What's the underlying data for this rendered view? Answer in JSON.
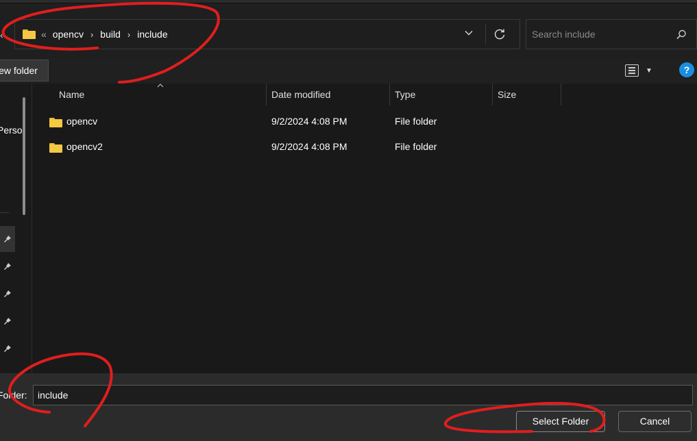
{
  "address_bar": {
    "overflow_glyph": "«",
    "breadcrumbs": [
      "opencv",
      "build",
      "include"
    ],
    "separator": "›",
    "dropdown_glyph": "⌄"
  },
  "search": {
    "placeholder": "Search include"
  },
  "command_bar": {
    "new_folder_label": "New folder",
    "help_label": "?"
  },
  "nav_pane": {
    "partial_text": "Perso"
  },
  "columns": [
    "Name",
    "Date modified",
    "Type",
    "Size"
  ],
  "files": [
    {
      "name": "opencv",
      "date_modified": "9/2/2024 4:08 PM",
      "type": "File folder",
      "size": ""
    },
    {
      "name": "opencv2",
      "date_modified": "9/2/2024 4:08 PM",
      "type": "File folder",
      "size": ""
    }
  ],
  "footer": {
    "folder_label": "Folder:",
    "folder_value": "include",
    "select_button": "Select Folder",
    "cancel_button": "Cancel"
  },
  "colors": {
    "background": "#191919",
    "accent_help": "#1a8fe0",
    "folder_yellow": "#f4c842",
    "annotation_red": "#e01e1e"
  }
}
